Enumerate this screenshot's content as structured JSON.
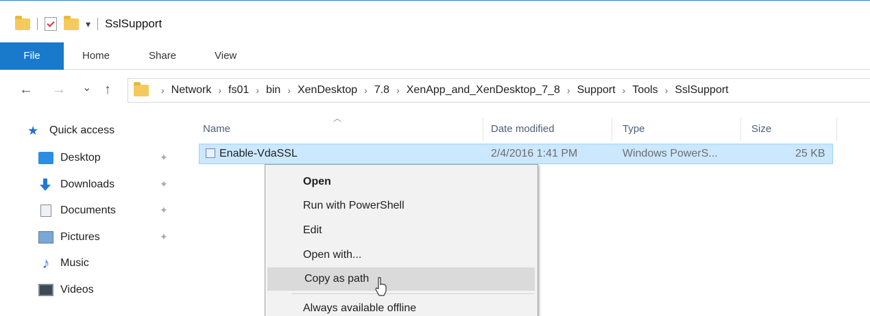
{
  "window": {
    "title": "SslSupport"
  },
  "quick_access_toolbar": {
    "dropdown_glyph": "▾"
  },
  "ribbon": {
    "tabs": [
      {
        "label": "File",
        "active": true
      },
      {
        "label": "Home"
      },
      {
        "label": "Share"
      },
      {
        "label": "View"
      }
    ],
    "accent_color": "#1979ca"
  },
  "nav_buttons": {
    "back": "←",
    "forward": "→",
    "recent": "⌄",
    "up": "↑"
  },
  "address_bar": {
    "breadcrumbs": [
      "Network",
      "fs01",
      "bin",
      "XenDesktop",
      "7.8",
      "XenApp_and_XenDesktop_7_8",
      "Support",
      "Tools",
      "SslSupport"
    ]
  },
  "navigation_pane": {
    "quick_access_label": "Quick access",
    "items": [
      {
        "label": "Desktop",
        "icon": "desktop-icon",
        "pinned": true
      },
      {
        "label": "Downloads",
        "icon": "downloads-icon",
        "pinned": true
      },
      {
        "label": "Documents",
        "icon": "documents-icon",
        "pinned": true
      },
      {
        "label": "Pictures",
        "icon": "pictures-icon",
        "pinned": true
      },
      {
        "label": "Music",
        "icon": "music-icon",
        "pinned": false
      },
      {
        "label": "Videos",
        "icon": "videos-icon",
        "pinned": false
      }
    ]
  },
  "file_list": {
    "columns": {
      "name": "Name",
      "date_modified": "Date modified",
      "type": "Type",
      "size": "Size"
    },
    "rows": [
      {
        "name": "Enable-VdaSSL",
        "date_modified": "2/4/2016 1:41 PM",
        "type": "Windows PowerS...",
        "size": "25 KB",
        "selected": true
      }
    ],
    "selection_color": "#cce8ff"
  },
  "context_menu": {
    "items": [
      {
        "label": "Open",
        "bold": true
      },
      {
        "label": "Run with PowerShell"
      },
      {
        "label": "Edit"
      },
      {
        "label": "Open with..."
      },
      {
        "label": "Copy as path",
        "hovered": true
      },
      {
        "label": "Always available offline"
      }
    ]
  }
}
